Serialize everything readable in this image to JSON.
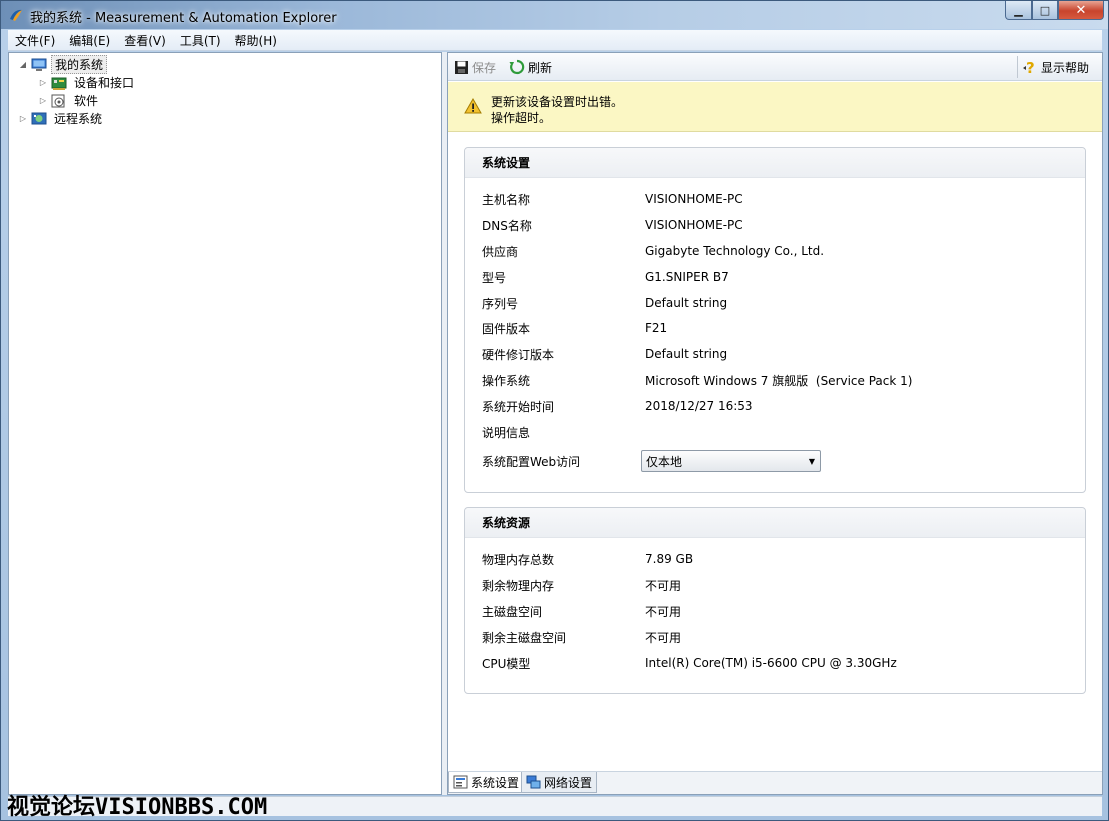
{
  "window": {
    "title": "我的系统 - Measurement & Automation Explorer",
    "minimize": "▁",
    "maximize": "□",
    "close": "✕"
  },
  "menu": [
    "文件(F)",
    "编辑(E)",
    "查看(V)",
    "工具(T)",
    "帮助(H)"
  ],
  "tree": {
    "root": "我的系统",
    "devices": "设备和接口",
    "software": "软件",
    "remote": "远程系统"
  },
  "toolbar": {
    "save": "保存",
    "refresh": "刷新",
    "help": "显示帮助"
  },
  "warning": {
    "line1": "更新该设备设置时出错。",
    "line2": "操作超时。"
  },
  "system_settings": {
    "title": "系统设置",
    "rows": [
      {
        "label": "主机名称",
        "value": "VISIONHOME-PC"
      },
      {
        "label": "DNS名称",
        "value": "VISIONHOME-PC"
      },
      {
        "label": "供应商",
        "value": "Gigabyte Technology Co., Ltd."
      },
      {
        "label": "型号",
        "value": "G1.SNIPER B7"
      },
      {
        "label": "序列号",
        "value": "Default string"
      },
      {
        "label": "固件版本",
        "value": "F21"
      },
      {
        "label": "硬件修订版本",
        "value": "Default string"
      },
      {
        "label": "操作系统",
        "value": "Microsoft Windows 7 旗舰版  (Service Pack 1)"
      },
      {
        "label": "系统开始时间",
        "value": "2018/12/27 16:53"
      },
      {
        "label": "说明信息",
        "value": ""
      }
    ],
    "web_access_label": "系统配置Web访问",
    "web_access_value": "仅本地"
  },
  "system_resources": {
    "title": "系统资源",
    "rows": [
      {
        "label": "物理内存总数",
        "value": "7.89 GB"
      },
      {
        "label": "剩余物理内存",
        "value": "不可用"
      },
      {
        "label": "主磁盘空间",
        "value": "不可用"
      },
      {
        "label": "剩余主磁盘空间",
        "value": "不可用"
      },
      {
        "label": "CPU模型",
        "value": "Intel(R) Core(TM) i5-6600 CPU @ 3.30GHz"
      }
    ]
  },
  "tabs": {
    "system_settings": "系统设置",
    "network_settings": "网络设置"
  },
  "watermark": "视觉论坛VISIONBBS.COM",
  "colors": {
    "titlebar": "#9bb8d9",
    "warning_bg": "#fbf7c4",
    "close_button": "#c8442d"
  }
}
